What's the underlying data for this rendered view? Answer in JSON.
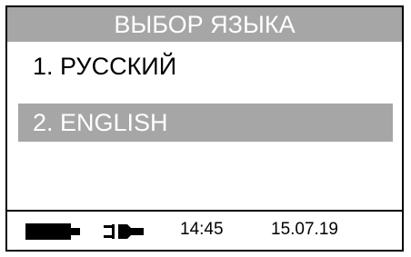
{
  "header": {
    "title": "ВЫБОР ЯЗЫКА"
  },
  "menu": {
    "items": [
      {
        "label": "1. РУССКИЙ",
        "selected": false
      },
      {
        "label": "2. ENGLISH",
        "selected": true
      }
    ]
  },
  "status_bar": {
    "battery_icon": "battery-icon",
    "power_icon": "plug-icon",
    "time": "14:45",
    "date": "15.07.19"
  },
  "colors": {
    "highlight": "#a6a6a6",
    "highlight_text": "#ffffff",
    "text": "#000000",
    "background": "#ffffff"
  }
}
